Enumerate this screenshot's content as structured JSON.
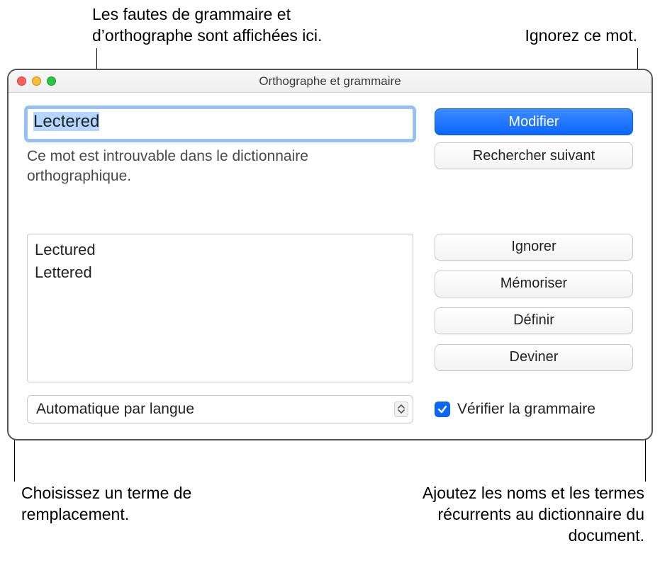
{
  "callouts": {
    "top_left": "Les fautes de grammaire et d’orthographe sont affichées ici.",
    "top_right": "Ignorez ce mot.",
    "bottom_left": "Choisissez un terme de remplacement.",
    "bottom_right": "Ajoutez les noms et les termes récurrents au dictionnaire du document."
  },
  "window": {
    "title": "Orthographe et grammaire",
    "current_word": "Lectered",
    "explanation": "Ce mot est introuvable dans le dictionnaire orthographique.",
    "suggestions": [
      "Lectured",
      "Lettered"
    ],
    "language_select": "Automatique par langue",
    "check_grammar_label": "Vérifier la grammaire",
    "check_grammar_checked": true,
    "buttons": {
      "change": "Modifier",
      "find_next": "Rechercher suivant",
      "ignore": "Ignorer",
      "learn": "Mémoriser",
      "define": "Définir",
      "guess": "Deviner"
    }
  }
}
